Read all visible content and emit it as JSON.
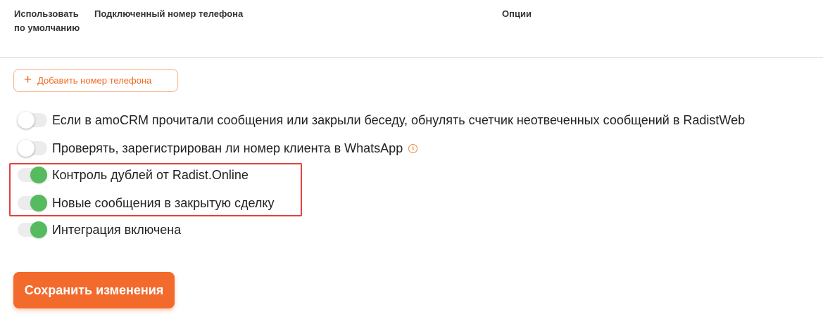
{
  "table": {
    "headers": {
      "default": "Использовать по умолчанию",
      "phone": "Подключенный номер телефона",
      "options": "Опции"
    }
  },
  "add_phone": {
    "label": "Добавить номер телефона",
    "icon": "plus-icon"
  },
  "toggles": [
    {
      "label": "Если в amoCRM прочитали сообщения или закрыли беседу, обнулять счетчик неотвеченных сообщений в RadistWeb",
      "state": "off"
    },
    {
      "label": "Проверять, зарегистрирован ли номер клиента в WhatsApp",
      "state": "off",
      "has_info_icon": true
    },
    {
      "label": "Контроль дублей от Radist.Online",
      "state": "on"
    },
    {
      "label": "Новые сообщения в закрытую сделку",
      "state": "on"
    },
    {
      "label": "Интеграция включена",
      "state": "on"
    }
  ],
  "info_icon_glyph": "i",
  "save_button": {
    "label": "Сохранить изменения"
  },
  "colors": {
    "accent": "#f26a2c",
    "toggle_on": "#55bb5e",
    "toggle_off_track": "#ececec",
    "highlight": "#e0433b"
  }
}
